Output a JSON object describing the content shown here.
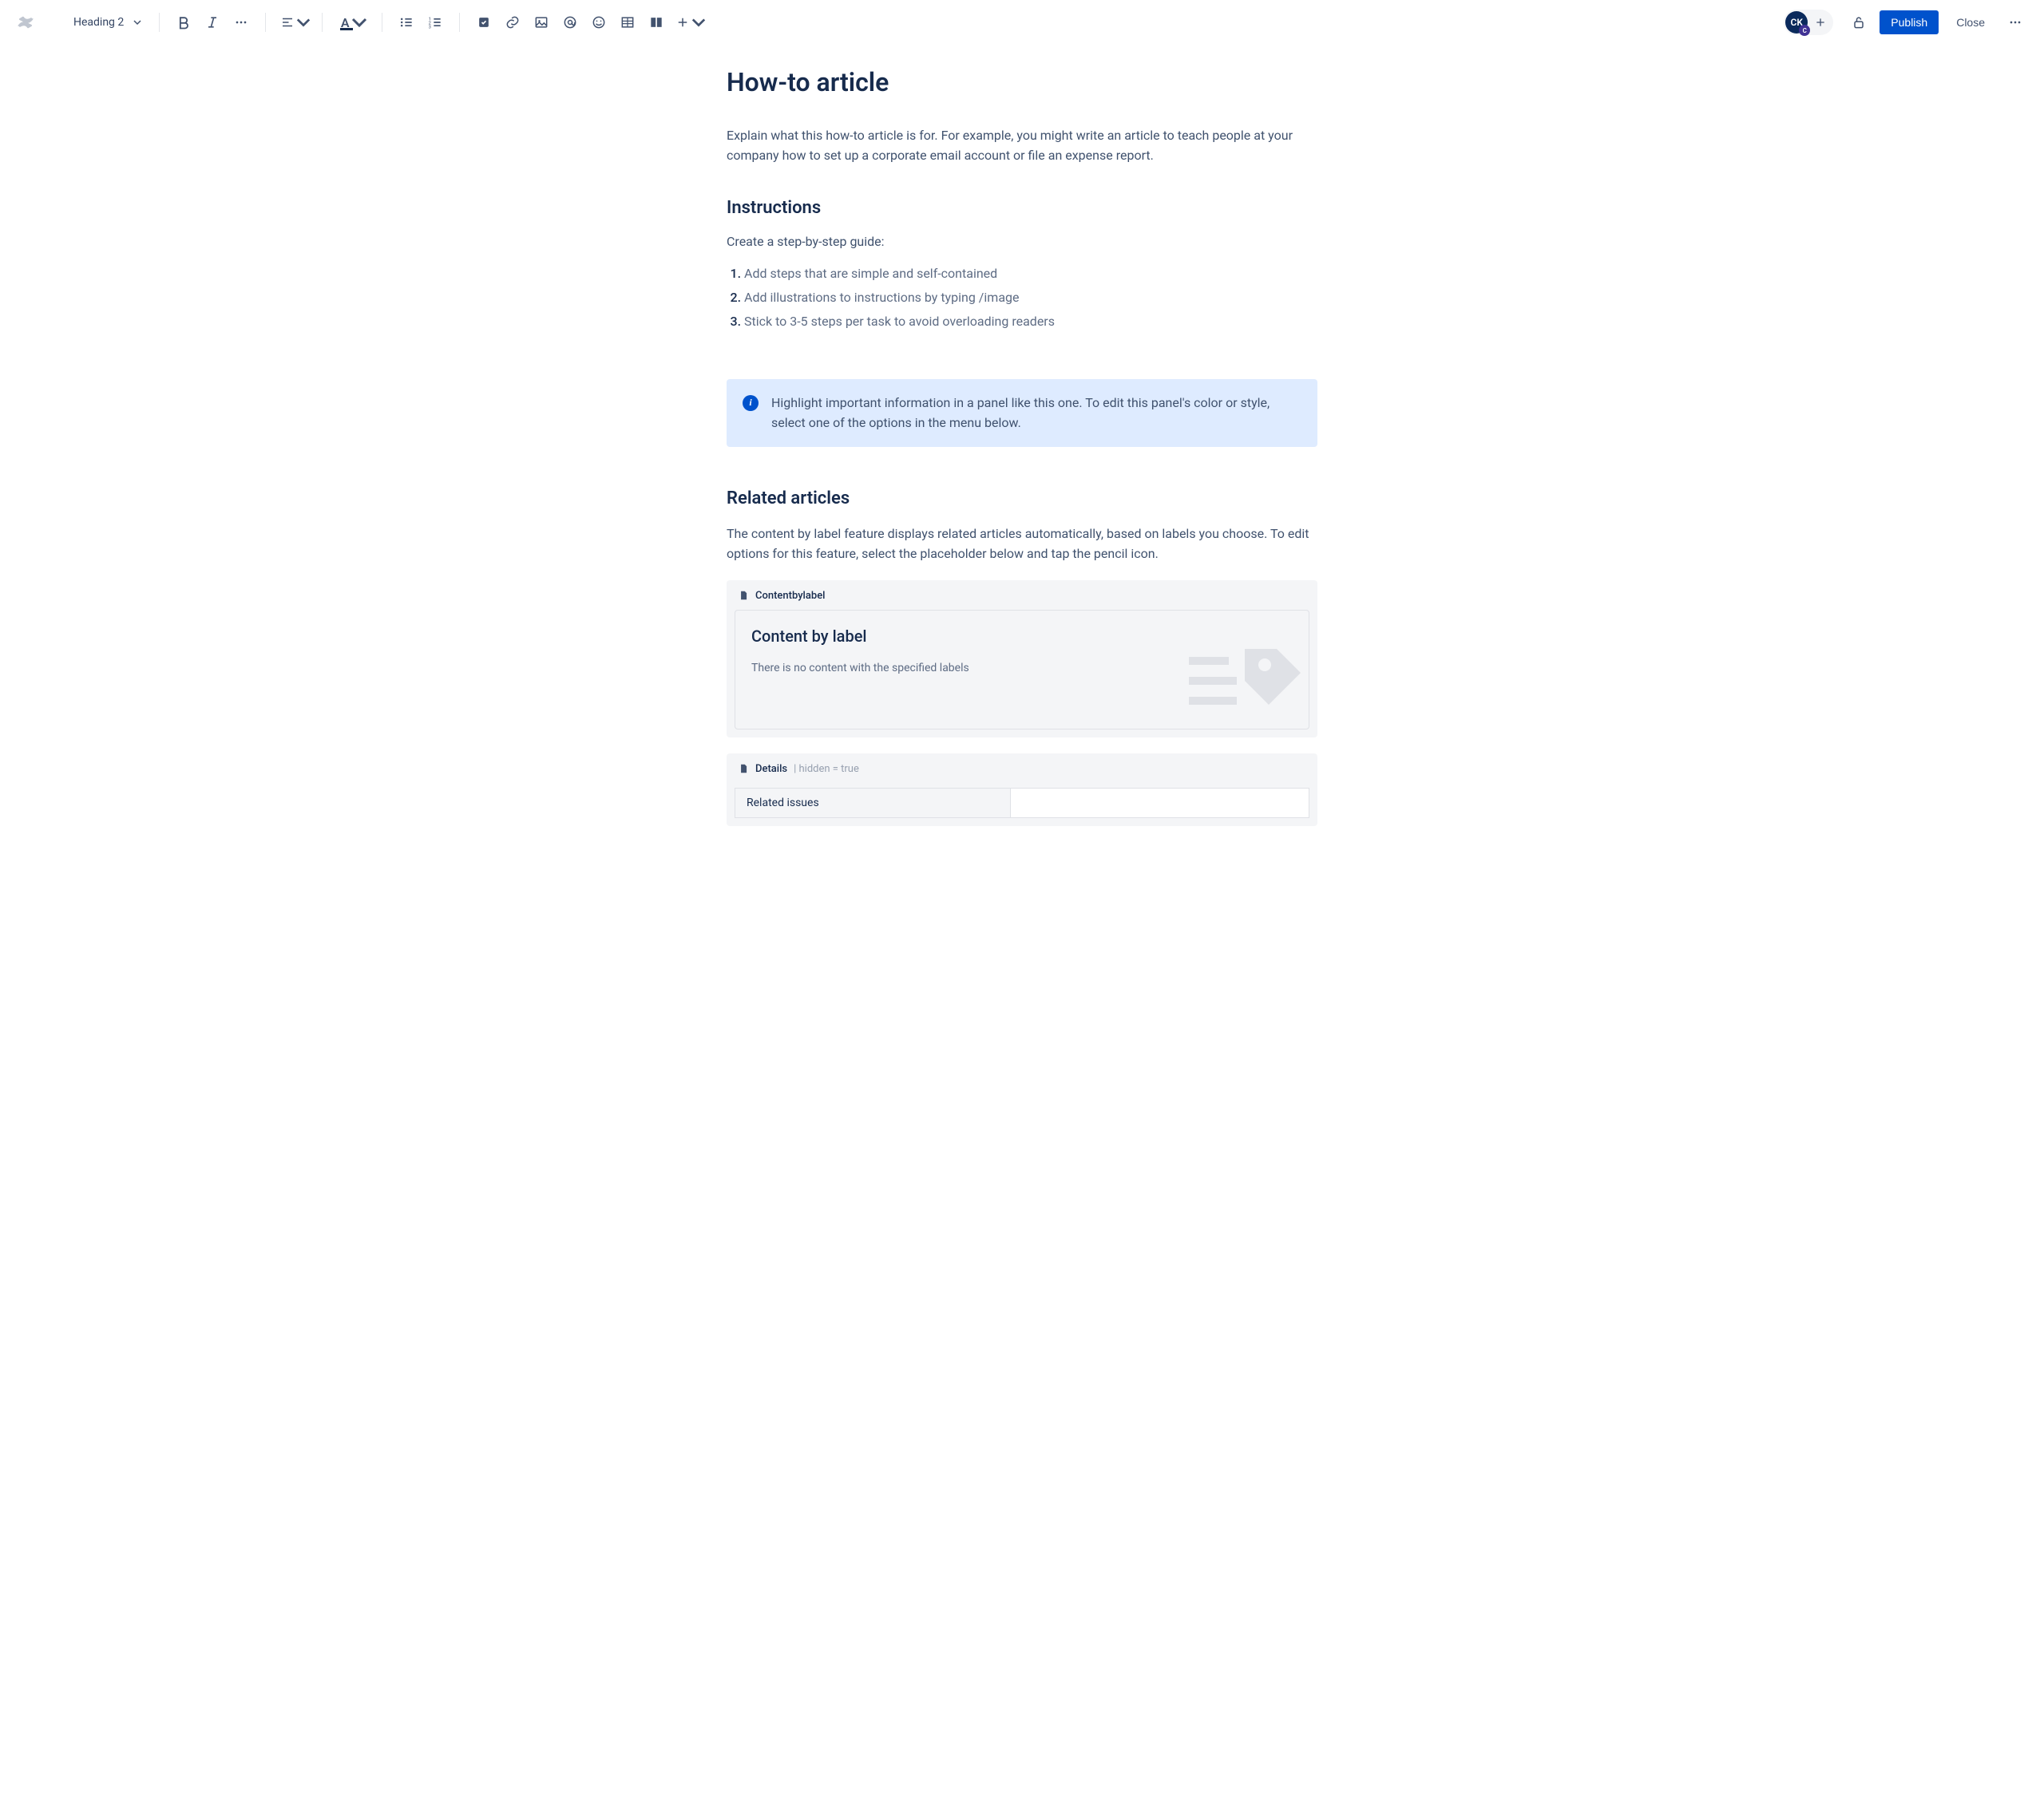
{
  "toolbar": {
    "heading_style": "Heading 2",
    "publish_label": "Publish",
    "close_label": "Close",
    "avatar_initials": "CK",
    "avatar_badge": "C"
  },
  "doc": {
    "title": "How-to article",
    "intro": "Explain what this how-to article is for. For example, you might write an article to teach people at your company how to set up a corporate email account or file an expense report.",
    "instructions_heading": "Instructions",
    "instructions_sub": "Create a step-by-step guide:",
    "steps": [
      "Add steps that are simple and self-contained",
      "Add illustrations to instructions by typing /image",
      "Stick to 3-5 steps per task to avoid overloading readers"
    ],
    "panel_text": "Highlight important information in a panel like this one. To edit this panel's color or style, select one of the options in the menu below.",
    "related_heading": "Related articles",
    "related_body": "The content by label feature displays related articles automatically, based on labels you choose. To edit options for this feature, select the placeholder below and tap the pencil icon."
  },
  "macros": {
    "cbl_name": "Contentbylabel",
    "cbl_title": "Content by label",
    "cbl_empty": "There is no content with the specified labels",
    "details_name": "Details",
    "details_meta": "| hidden = true",
    "details_row_label": "Related issues"
  }
}
